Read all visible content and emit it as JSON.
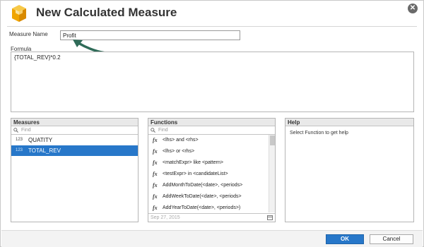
{
  "dialog": {
    "title": "New Calculated Measure",
    "close_icon": "close-icon"
  },
  "measure_name": {
    "label": "Measure Name",
    "value": "Profit"
  },
  "formula": {
    "label": "Formula",
    "value": "{TOTAL_REV}*0.2"
  },
  "measures": {
    "header": "Measures",
    "find_placeholder": "Find",
    "items": [
      {
        "type": "123",
        "label": "QUATITY",
        "selected": false
      },
      {
        "type": "123",
        "label": "TOTAL_REV",
        "selected": true
      }
    ]
  },
  "functions": {
    "header": "Functions",
    "find_placeholder": "Find",
    "items": [
      "<lhs> and <rhs>",
      "<lhs> or <rhs>",
      "<matchExpr> like <pattern>",
      "<testExpr> in <candidateList>",
      "AddMonthToDate(<date>, <periods>",
      "AddWeekToDate(<date>, <periods>",
      "AddYearToDate(<date>, <periods>)"
    ],
    "footer_date": "Sep 27, 2015"
  },
  "help": {
    "header": "Help",
    "text": "Select Function to get help"
  },
  "buttons": {
    "ok": "OK",
    "cancel": "Cancel"
  },
  "colors": {
    "accent": "#2777c9",
    "arrow": "#2f6b58",
    "title_icon": "#f0a500"
  }
}
